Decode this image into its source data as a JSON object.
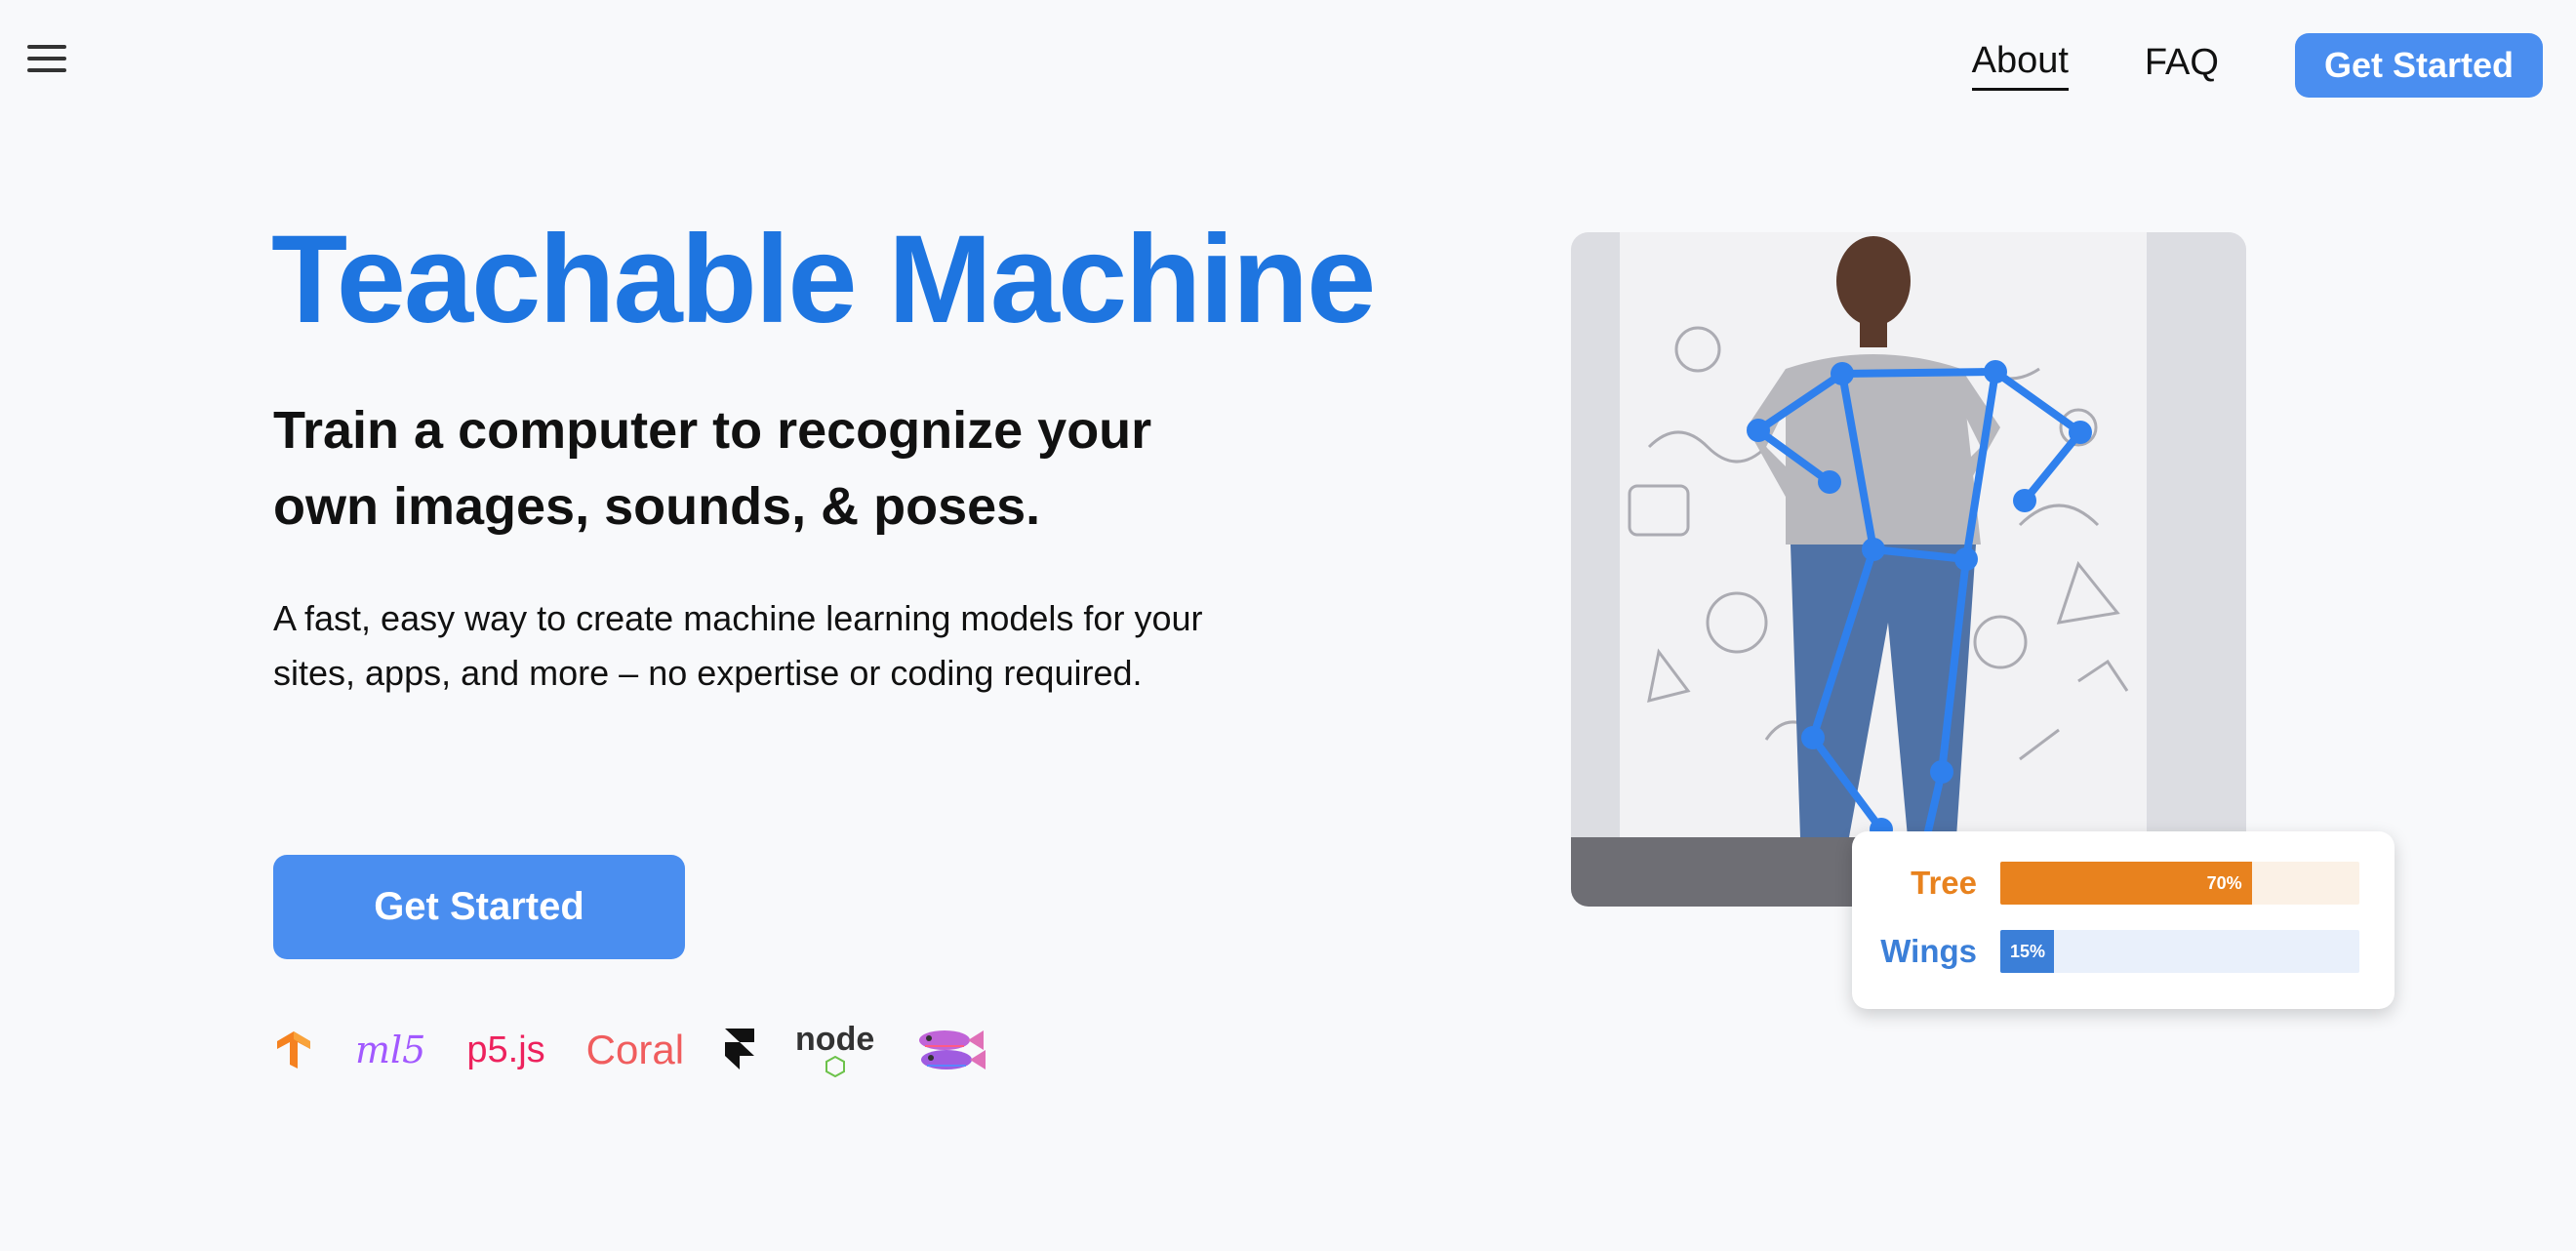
{
  "header": {
    "menu_icon": "hamburger-menu-icon",
    "nav": [
      {
        "label": "About",
        "active": true
      },
      {
        "label": "FAQ",
        "active": false
      }
    ],
    "cta_label": "Get Started"
  },
  "hero": {
    "title": "Teachable Machine",
    "subtitle": "Train a computer to recognize your own images, sounds, & poses.",
    "description": "A fast, easy way to create machine learning models for your sites, apps, and more – no expertise or coding required.",
    "cta_label": "Get Started",
    "logos": [
      {
        "name": "tensorflow-logo-icon",
        "color": "#f58220"
      },
      {
        "name": "ml5-logo-icon",
        "text": "ml5",
        "color": "#a259ff"
      },
      {
        "name": "p5js-logo-icon",
        "text": "p5.js",
        "color": "#ed225d"
      },
      {
        "name": "coral-logo-icon",
        "text": "Coral",
        "color": "#f05d5e"
      },
      {
        "name": "framer-logo-icon",
        "color": "#111111"
      },
      {
        "name": "nodejs-logo-icon",
        "text": "node",
        "color": "#333333"
      },
      {
        "name": "fish-logo-icon",
        "color": "#c064d8"
      }
    ]
  },
  "visual": {
    "image": "person-pose-skeleton-image",
    "predictions": [
      {
        "label": "Tree",
        "percent": 70,
        "percent_label": "70%",
        "color": "#e8821e",
        "track": "#fbf1e6"
      },
      {
        "label": "Wings",
        "percent": 15,
        "percent_label": "15%",
        "color": "#3b7fd8",
        "track": "#e9f0fb"
      }
    ]
  },
  "colors": {
    "accent": "#1e75e0",
    "button": "#4a8ef0",
    "background": "#f8f9fb"
  }
}
